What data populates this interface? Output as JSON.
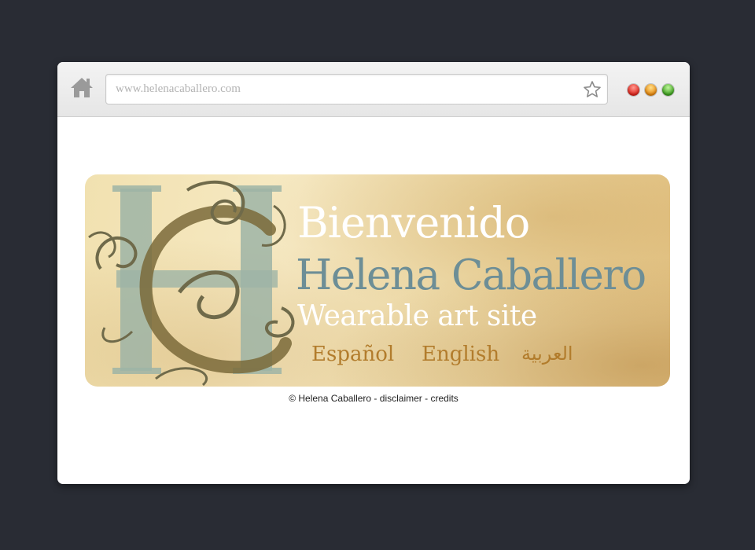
{
  "browser": {
    "url": "www.helenacaballero.com",
    "icons": {
      "home": "home-icon",
      "bookmark": "star-icon",
      "close": "close-dot",
      "minimize": "minimize-dot",
      "maximize": "maximize-dot"
    },
    "colors": {
      "close": "#e0241c",
      "minimize": "#e8880e",
      "maximize": "#3ea21f"
    }
  },
  "banner": {
    "greeting": "Bienvenido",
    "name": "Helena Caballero",
    "tagline": "Wearable art site",
    "languages": {
      "spanish": "Español",
      "english": "English",
      "arabic": "العربية"
    },
    "colors": {
      "name": "#6d8e96",
      "languages": "#b27c2c"
    }
  },
  "footer": {
    "copyright": "© Helena Caballero",
    "separator": " - ",
    "disclaimer": "disclaimer",
    "credits": "credits"
  }
}
